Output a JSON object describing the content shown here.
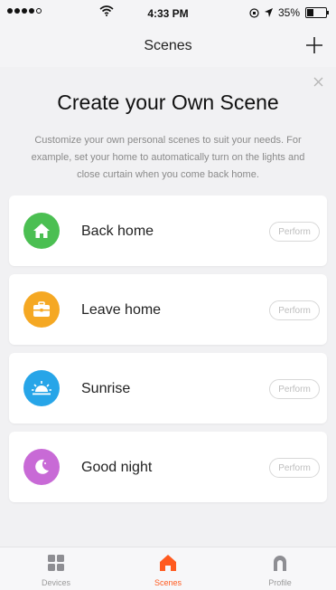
{
  "status_bar": {
    "time": "4:33 PM",
    "battery": "35%"
  },
  "header": {
    "title": "Scenes",
    "add_icon": "plus-icon"
  },
  "banner": {
    "title": "Create your Own Scene",
    "description": "Customize your own personal scenes to suit your needs. For example, set your home to automatically turn on the lights and close curtain when you come back home.",
    "close_icon": "close-icon"
  },
  "scenes": [
    {
      "name": "Back home",
      "action": "Perform",
      "icon": "home-icon",
      "color": "#4bbf52"
    },
    {
      "name": "Leave home",
      "action": "Perform",
      "icon": "briefcase-icon",
      "color": "#f5a823"
    },
    {
      "name": "Sunrise",
      "action": "Perform",
      "icon": "sunrise-icon",
      "color": "#27a5e8"
    },
    {
      "name": "Good night",
      "action": "Perform",
      "icon": "moon-icon",
      "color": "#c86ad6"
    }
  ],
  "tabs": [
    {
      "label": "Devices",
      "icon": "grid-icon",
      "active": false
    },
    {
      "label": "Scenes",
      "icon": "home-icon",
      "active": true
    },
    {
      "label": "Profile",
      "icon": "profile-icon",
      "active": false
    }
  ],
  "colors": {
    "accent": "#ff5a1f",
    "background": "#f1f1f3"
  }
}
